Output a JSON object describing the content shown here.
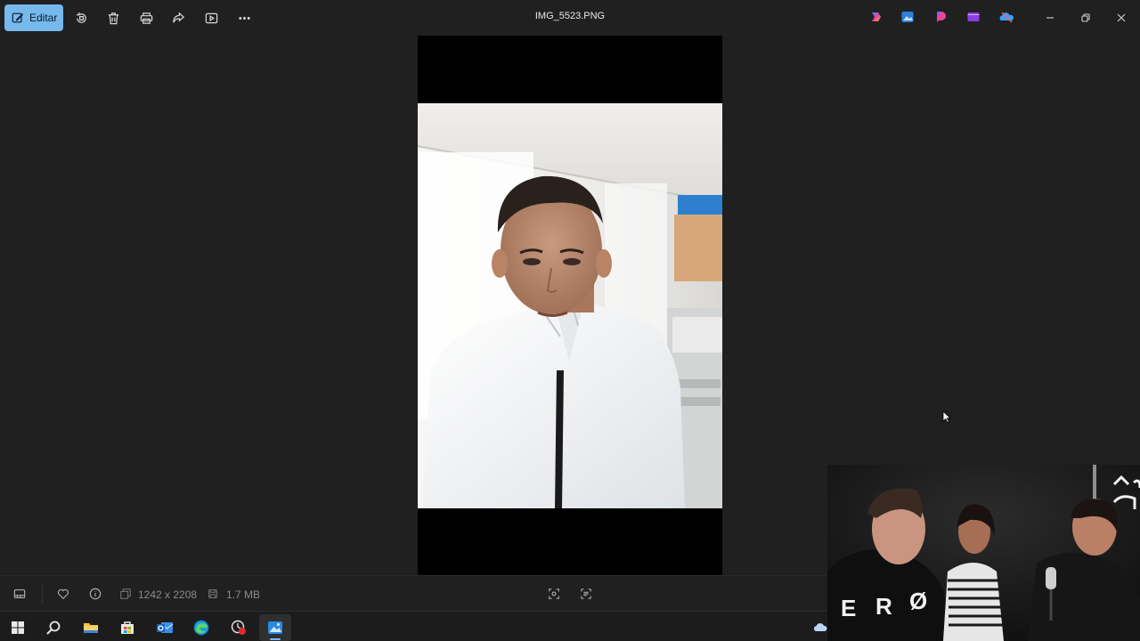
{
  "window": {
    "title": "IMG_5523.PNG"
  },
  "toolbar": {
    "edit_label": "Editar",
    "icons": [
      "edit-icon",
      "rotate-icon",
      "delete-icon",
      "print-icon",
      "share-icon",
      "slideshow-icon",
      "more-icon"
    ]
  },
  "app_icons": [
    "copilot-icon",
    "photos-app-icon",
    "designer-icon",
    "clipchamp-icon",
    "onedrive-icon"
  ],
  "window_controls": [
    "minimize-icon",
    "restore-icon",
    "close-icon"
  ],
  "infobar": {
    "dimensions": "1242 x 2208",
    "file_size": "1.7 MB"
  },
  "taskbar": {
    "items": [
      "start",
      "search",
      "file-explorer",
      "store",
      "outlook",
      "edge",
      "recording-app",
      "photos"
    ]
  },
  "colors": {
    "accent": "#76b9ed",
    "background": "#202020",
    "taskbar": "#1c1c1c"
  }
}
